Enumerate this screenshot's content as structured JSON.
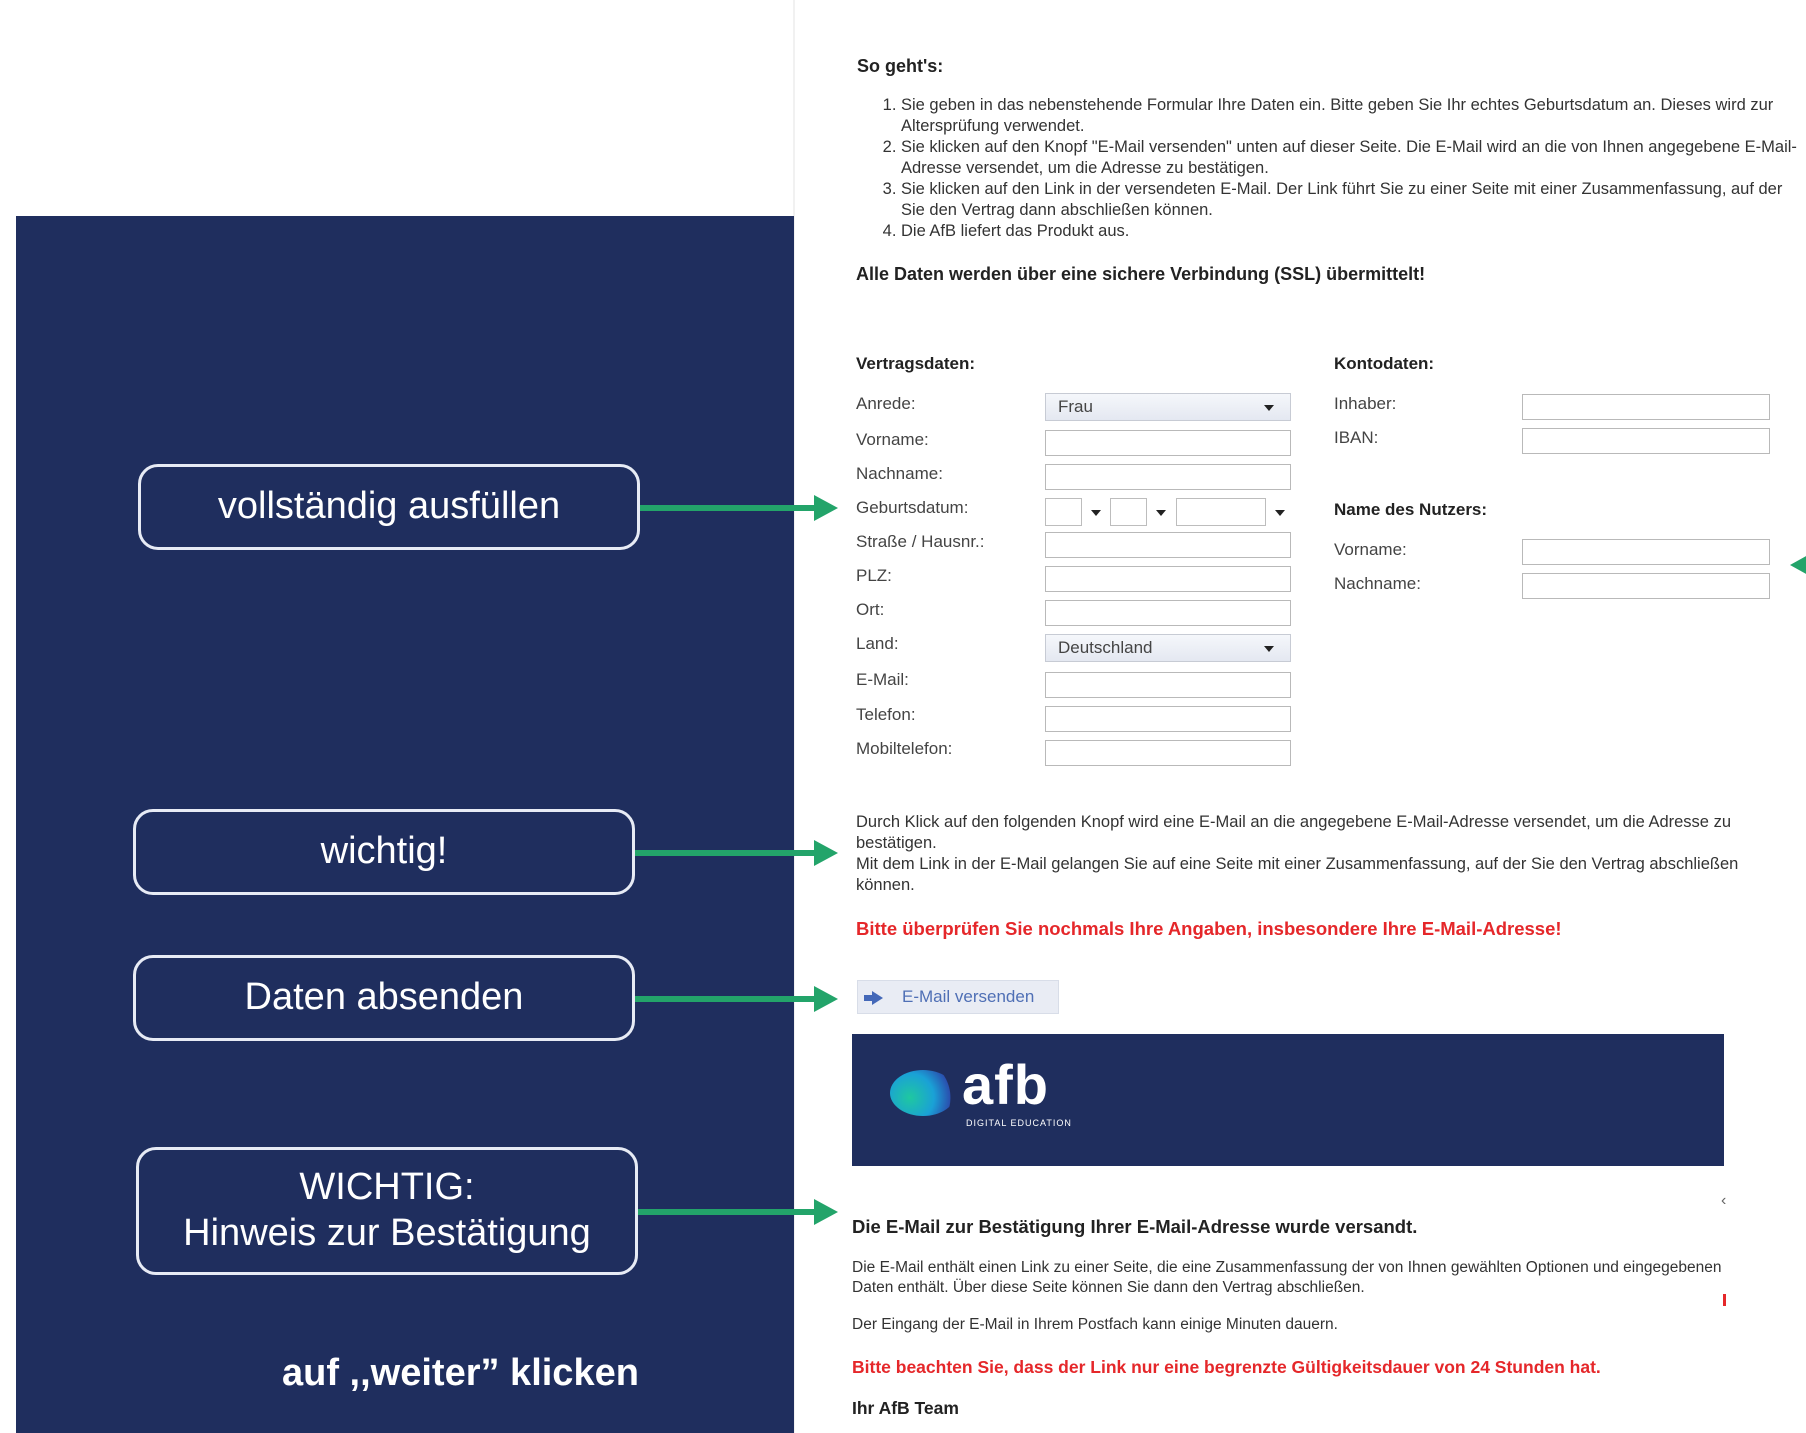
{
  "left_panel": {
    "callouts": {
      "fill_out": "vollständig ausfüllen",
      "important": "wichtig!",
      "send_data": "Daten absenden",
      "confirmation_line1": "WICHTIG:",
      "confirmation_line2": "Hinweis zur Bestätigung"
    },
    "footer_note": "auf ,,weiter” klicken"
  },
  "page": {
    "how_title": "So geht's:",
    "steps": [
      "Sie geben in das nebenstehende Formular Ihre Daten ein. Bitte geben Sie Ihr echtes Geburtsdatum an. Dieses wird zur Altersprüfung verwendet.",
      "Sie klicken auf den Knopf \"E-Mail versenden\" unten auf dieser Seite. Die E-Mail wird an die von Ihnen angegebene E-Mail-Adresse versendet, um die Adresse zu bestätigen.",
      "Sie klicken auf den Link in der versendeten E-Mail. Der Link führt Sie zu einer Seite mit einer Zusammenfassung, auf der Sie den Vertrag dann abschließen können.",
      "Die AfB liefert das Produkt aus."
    ],
    "ssl_note": "Alle Daten werden über eine sichere Verbindung (SSL) übermittelt!",
    "contract": {
      "title": "Vertragsdaten:",
      "anrede_label": "Anrede:",
      "anrede_value": "Frau",
      "vorname_label": "Vorname:",
      "nachname_label": "Nachname:",
      "geburtsdatum_label": "Geburtsdatum:",
      "strasse_label": "Straße / Hausnr.:",
      "plz_label": "PLZ:",
      "ort_label": "Ort:",
      "land_label": "Land:",
      "land_value": "Deutschland",
      "email_label": "E-Mail:",
      "telefon_label": "Telefon:",
      "mobil_label": "Mobiltelefon:"
    },
    "account": {
      "title": "Kontodaten:",
      "inhaber_label": "Inhaber:",
      "iban_label": "IBAN:"
    },
    "user": {
      "title": "Name des Nutzers:",
      "vorname_label": "Vorname:",
      "nachname_label": "Nachname:"
    },
    "info_text_1": "Durch Klick auf den folgenden Knopf wird eine E-Mail an die angegebene E-Mail-Adresse versendet, um die Adresse zu bestätigen.",
    "info_text_2": "Mit dem Link in der E-Mail gelangen Sie auf eine Seite mit einer Zusammenfassung, auf der Sie den Vertrag abschließen können.",
    "warning": "Bitte überprüfen Sie nochmals Ihre Angaben, insbesondere Ihre E-Mail-Adresse!",
    "send_button": "E-Mail versenden"
  },
  "banner": {
    "logo_text": "afb",
    "logo_subtext": "DIGITAL EDUCATION"
  },
  "confirmation": {
    "title": "Die E-Mail zur Bestätigung Ihrer E-Mail-Adresse wurde versandt.",
    "text_1": "Die E-Mail enthält einen Link zu einer Seite, die eine Zusammenfassung der von Ihnen gewählten Optionen und eingegebenen Daten enthält. Über diese Seite können Sie dann den Vertrag abschließen.",
    "text_2": "Der Eingang der E-Mail in Ihrem Postfach kann einige Minuten dauern.",
    "validity_warning": "Bitte beachten Sie, dass der Link nur eine begrenzte Gültigkeitsdauer von 24 Stunden hat.",
    "signoff": "Ihr AfB Team",
    "stray_mark": "‹"
  },
  "colors": {
    "panel_navy": "#1f2e5e",
    "arrow_green": "#23a46a",
    "warning_red": "#e5272a"
  }
}
